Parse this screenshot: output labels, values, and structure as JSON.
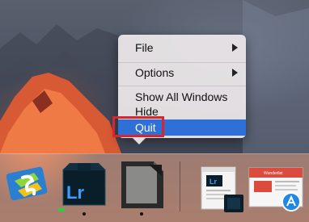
{
  "context_menu": {
    "items": [
      {
        "label": "File",
        "has_submenu": true
      },
      {
        "label": "Options",
        "has_submenu": true
      },
      {
        "label": "Show All Windows",
        "has_submenu": false
      },
      {
        "label": "Hide",
        "has_submenu": false
      },
      {
        "label": "Quit",
        "has_submenu": false,
        "highlighted": true
      }
    ]
  },
  "dock": {
    "apps": [
      {
        "name": "Subtitle Edit",
        "icon": "subtitle-edit-icon"
      },
      {
        "name": "Lightroom",
        "icon_text": "Lr",
        "icon": "lightroom-icon",
        "running": true
      },
      {
        "name": "LibreOffice",
        "icon": "libreoffice-icon",
        "running": true
      }
    ],
    "windows": [
      {
        "name": "Lightroom window",
        "icon_text": "Lr",
        "icon": "lightroom-window-thumbnail"
      },
      {
        "name": "Wunderlist window",
        "title": "Wunderlist",
        "icon": "wunderlist-window-thumbnail"
      }
    ]
  },
  "colors": {
    "highlight": "#2f6fd8",
    "annotation_outline": "#d8262d",
    "lightroom_blue": "#3aa0ff",
    "lightroom_bg": "#0a1e2a",
    "wunderlist_red": "#db4c3f"
  }
}
